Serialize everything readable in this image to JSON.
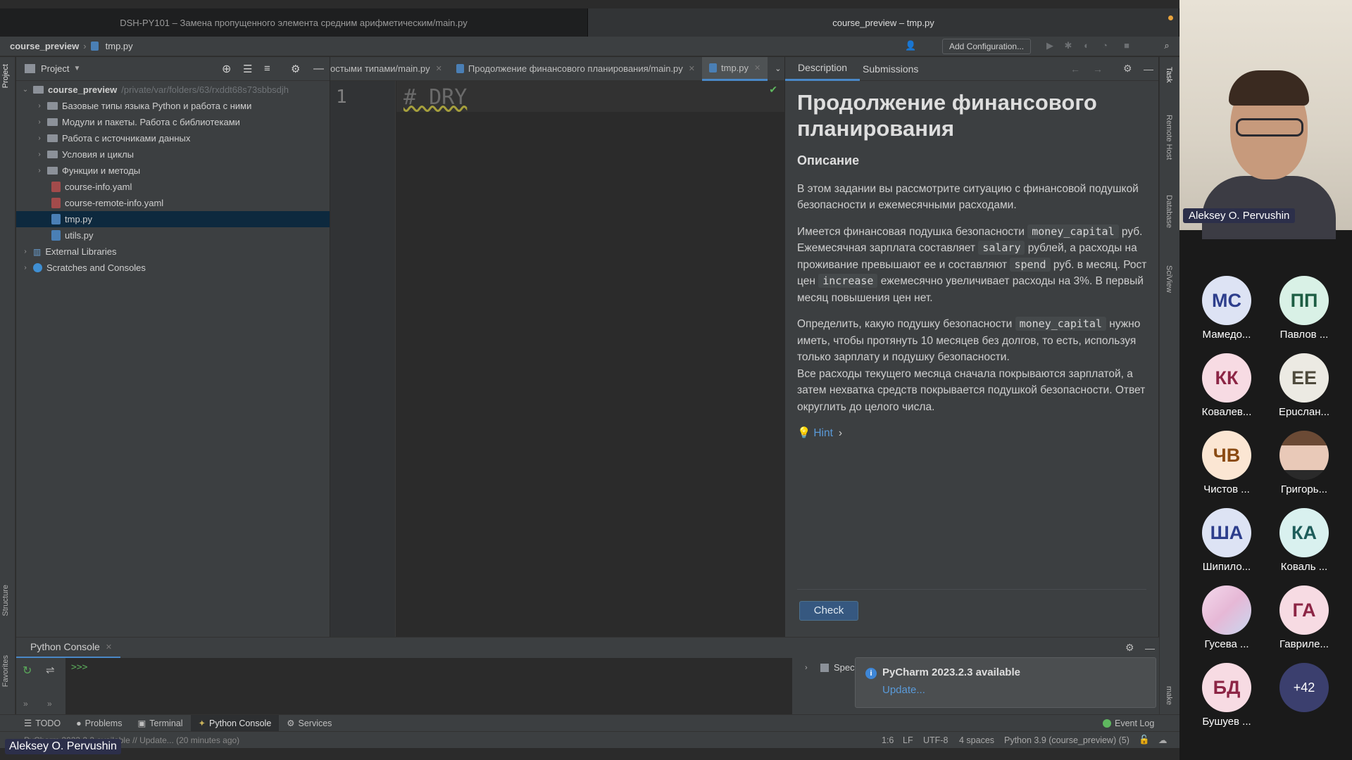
{
  "window_tabs": [
    {
      "label": "DSH-PY101 – Замена пропущенного элемента средним арифметическим/main.py",
      "active": false
    },
    {
      "label": "course_preview – tmp.py",
      "active": true
    }
  ],
  "navbar": {
    "project": "course_preview",
    "file": "tmp.py",
    "add_config": "Add Configuration..."
  },
  "left_stripe": {
    "project": "Project",
    "structure": "Structure",
    "favorites": "Favorites"
  },
  "project_panel": {
    "title": "Project",
    "root": {
      "name": "course_preview",
      "path": "/private/var/folders/63/rxddt68s73sbbsdjh"
    },
    "items": [
      {
        "label": "Базовые типы языка Python и работа с ними",
        "type": "folder"
      },
      {
        "label": "Модули и пакеты. Работа с библиотеками",
        "type": "folder"
      },
      {
        "label": "Работа с источниками данных",
        "type": "folder"
      },
      {
        "label": "Условия и циклы",
        "type": "folder"
      },
      {
        "label": "Функции и методы",
        "type": "folder"
      },
      {
        "label": "course-info.yaml",
        "type": "yaml"
      },
      {
        "label": "course-remote-info.yaml",
        "type": "yaml"
      },
      {
        "label": "tmp.py",
        "type": "py",
        "selected": true
      },
      {
        "label": "utils.py",
        "type": "py"
      }
    ],
    "external_libraries": "External Libraries",
    "scratches": "Scratches and Consoles"
  },
  "editor_tabs": [
    {
      "label": "остыми типами/main.py",
      "active": false
    },
    {
      "label": "Продолжение финансового планирования/main.py",
      "active": false
    },
    {
      "label": "tmp.py",
      "active": true
    }
  ],
  "editor": {
    "line_number": "1",
    "code": "# DRY"
  },
  "task_panel": {
    "tabs": [
      "Description",
      "Submissions"
    ],
    "title": "Продолжение финансового планирования",
    "subtitle": "Описание",
    "p1": "В этом задании вы рассмотрите ситуацию с финансовой подушкой безопасности и ежемесячными расходами.",
    "p2": {
      "a": "Имеется финансовая подушка безопасности ",
      "code1": "money_capital",
      "b": " руб. Ежемесячная зарплата составляет ",
      "code2": "salary",
      "c": " рублей, а расходы на проживание превышают ее и составляют ",
      "code3": "spend",
      "d": " руб. в месяц. Рост цен ",
      "code4": "increase",
      "e": " ежемесячно увеличивает расходы на 3%. В первый месяц повышения цен нет."
    },
    "p3": {
      "a": "Определить, какую подушку безопасности ",
      "code1": "money_capital",
      "b": " нужно иметь, чтобы протянуть 10 месяцев без долгов, то есть, используя только зарплату и подушку безопасности.",
      "c": "Все расходы текущего месяца сначала покрываются зарплатой, а затем нехватка средств покрывается подушкой безопасности. Ответ округлить до целого числа."
    },
    "hint": "Hint",
    "check": "Check"
  },
  "right_stripe": {
    "task": "Task",
    "remote_host": "Remote Host",
    "database": "Database",
    "sciview": "SciView",
    "make": "make"
  },
  "console": {
    "title": "Python Console",
    "prompt": ">>>",
    "spec": "Spec"
  },
  "notification": {
    "title": "PyCharm 2023.2.3 available",
    "link": "Update..."
  },
  "tool_windows": [
    {
      "label": "TODO",
      "icon": "list-icon"
    },
    {
      "label": "Problems",
      "icon": "warning-icon"
    },
    {
      "label": "Terminal",
      "icon": "terminal-icon"
    },
    {
      "label": "Python Console",
      "icon": "python-icon",
      "active": true
    },
    {
      "label": "Services",
      "icon": "services-icon"
    }
  ],
  "event_log": "Event Log",
  "status": {
    "message": "PyCharm 2023.2.3 available // Update... (20 minutes ago)",
    "position": "1:6",
    "line_sep": "LF",
    "encoding": "UTF-8",
    "indent": "4 spaces",
    "interpreter": "Python 3.9 (course_preview) (5)"
  },
  "video": {
    "presenter": "Aleksey O. Pervushin",
    "participants": [
      {
        "initials": "МС",
        "name": "Мамедо...",
        "bg": "#dde3f4",
        "fg": "#2d3e8c"
      },
      {
        "initials": "ПП",
        "name": "Павлов ...",
        "bg": "#d9f1e6",
        "fg": "#1d5d43"
      },
      {
        "initials": "КК",
        "name": "Ковалев...",
        "bg": "#f7dbe3",
        "fg": "#8c2545"
      },
      {
        "initials": "ЕЕ",
        "name": "Ерuслан...",
        "bg": "#eceae3",
        "fg": "#4e4a3c"
      },
      {
        "initials": "ЧВ",
        "name": "Чистов ...",
        "bg": "#fbe6d3",
        "fg": "#8a4a12"
      },
      {
        "initials": "",
        "name": "Григорь...",
        "bg": "#e9c9b8",
        "fg": "#333"
      },
      {
        "initials": "ША",
        "name": "Шипило...",
        "bg": "#dde3f4",
        "fg": "#2d3e8c"
      },
      {
        "initials": "КА",
        "name": "Коваль ...",
        "bg": "#d9f1ef",
        "fg": "#1d5d5a"
      },
      {
        "initials": "",
        "name": "Гусева ...",
        "bg": "#f0d7e8",
        "fg": "#333"
      },
      {
        "initials": "ГА",
        "name": "Гавриле...",
        "bg": "#f7dbe3",
        "fg": "#8c2545"
      },
      {
        "initials": "БД",
        "name": "Бушуев ...",
        "bg": "#f7dbe3",
        "fg": "#8c2545"
      },
      {
        "initials": "+42",
        "name": "",
        "bg": "#3b3f6e",
        "fg": "#ffffff"
      }
    ]
  }
}
